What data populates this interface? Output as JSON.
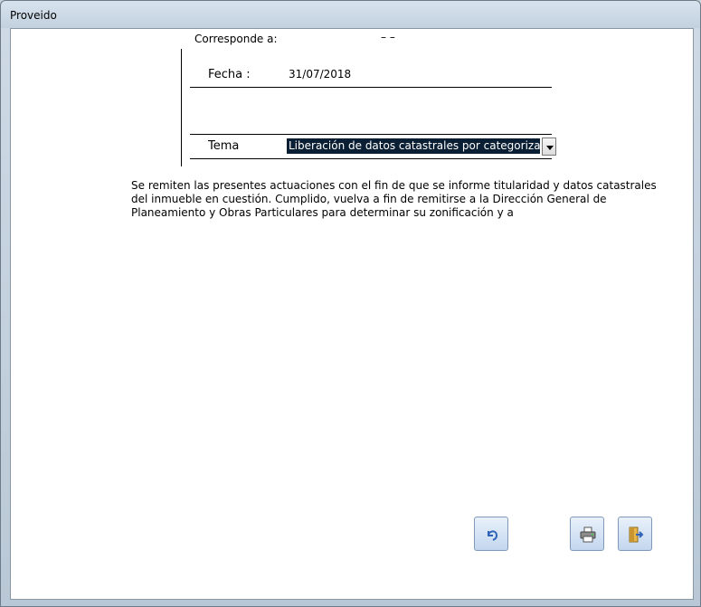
{
  "window": {
    "title": "Proveido"
  },
  "header": {
    "corresponde_label": "Corresponde a:",
    "corresponde_value": "–   –"
  },
  "form": {
    "fecha_label": "Fecha :",
    "fecha_value": "31/07/2018",
    "tema_label": "Tema",
    "tema_value": "Liberación de datos catastrales  por categorización i"
  },
  "body": {
    "text": "Se remiten las presentes actuaciones con el fin de que se informe titularidad y datos catastrales del inmueble en cuestión. Cumplido, vuelva a fin de remitirse a la Dirección General de Planeamiento y Obras Particulares para determinar su zonificación y a"
  },
  "toolbar": {
    "undo_icon": "undo-icon",
    "print_icon": "printer-icon",
    "exit_icon": "exit-door-icon"
  },
  "colors": {
    "selection_bg": "#0a1f33",
    "button_bg": "#c3d6ee",
    "undo_arrow": "#2f63b8"
  }
}
